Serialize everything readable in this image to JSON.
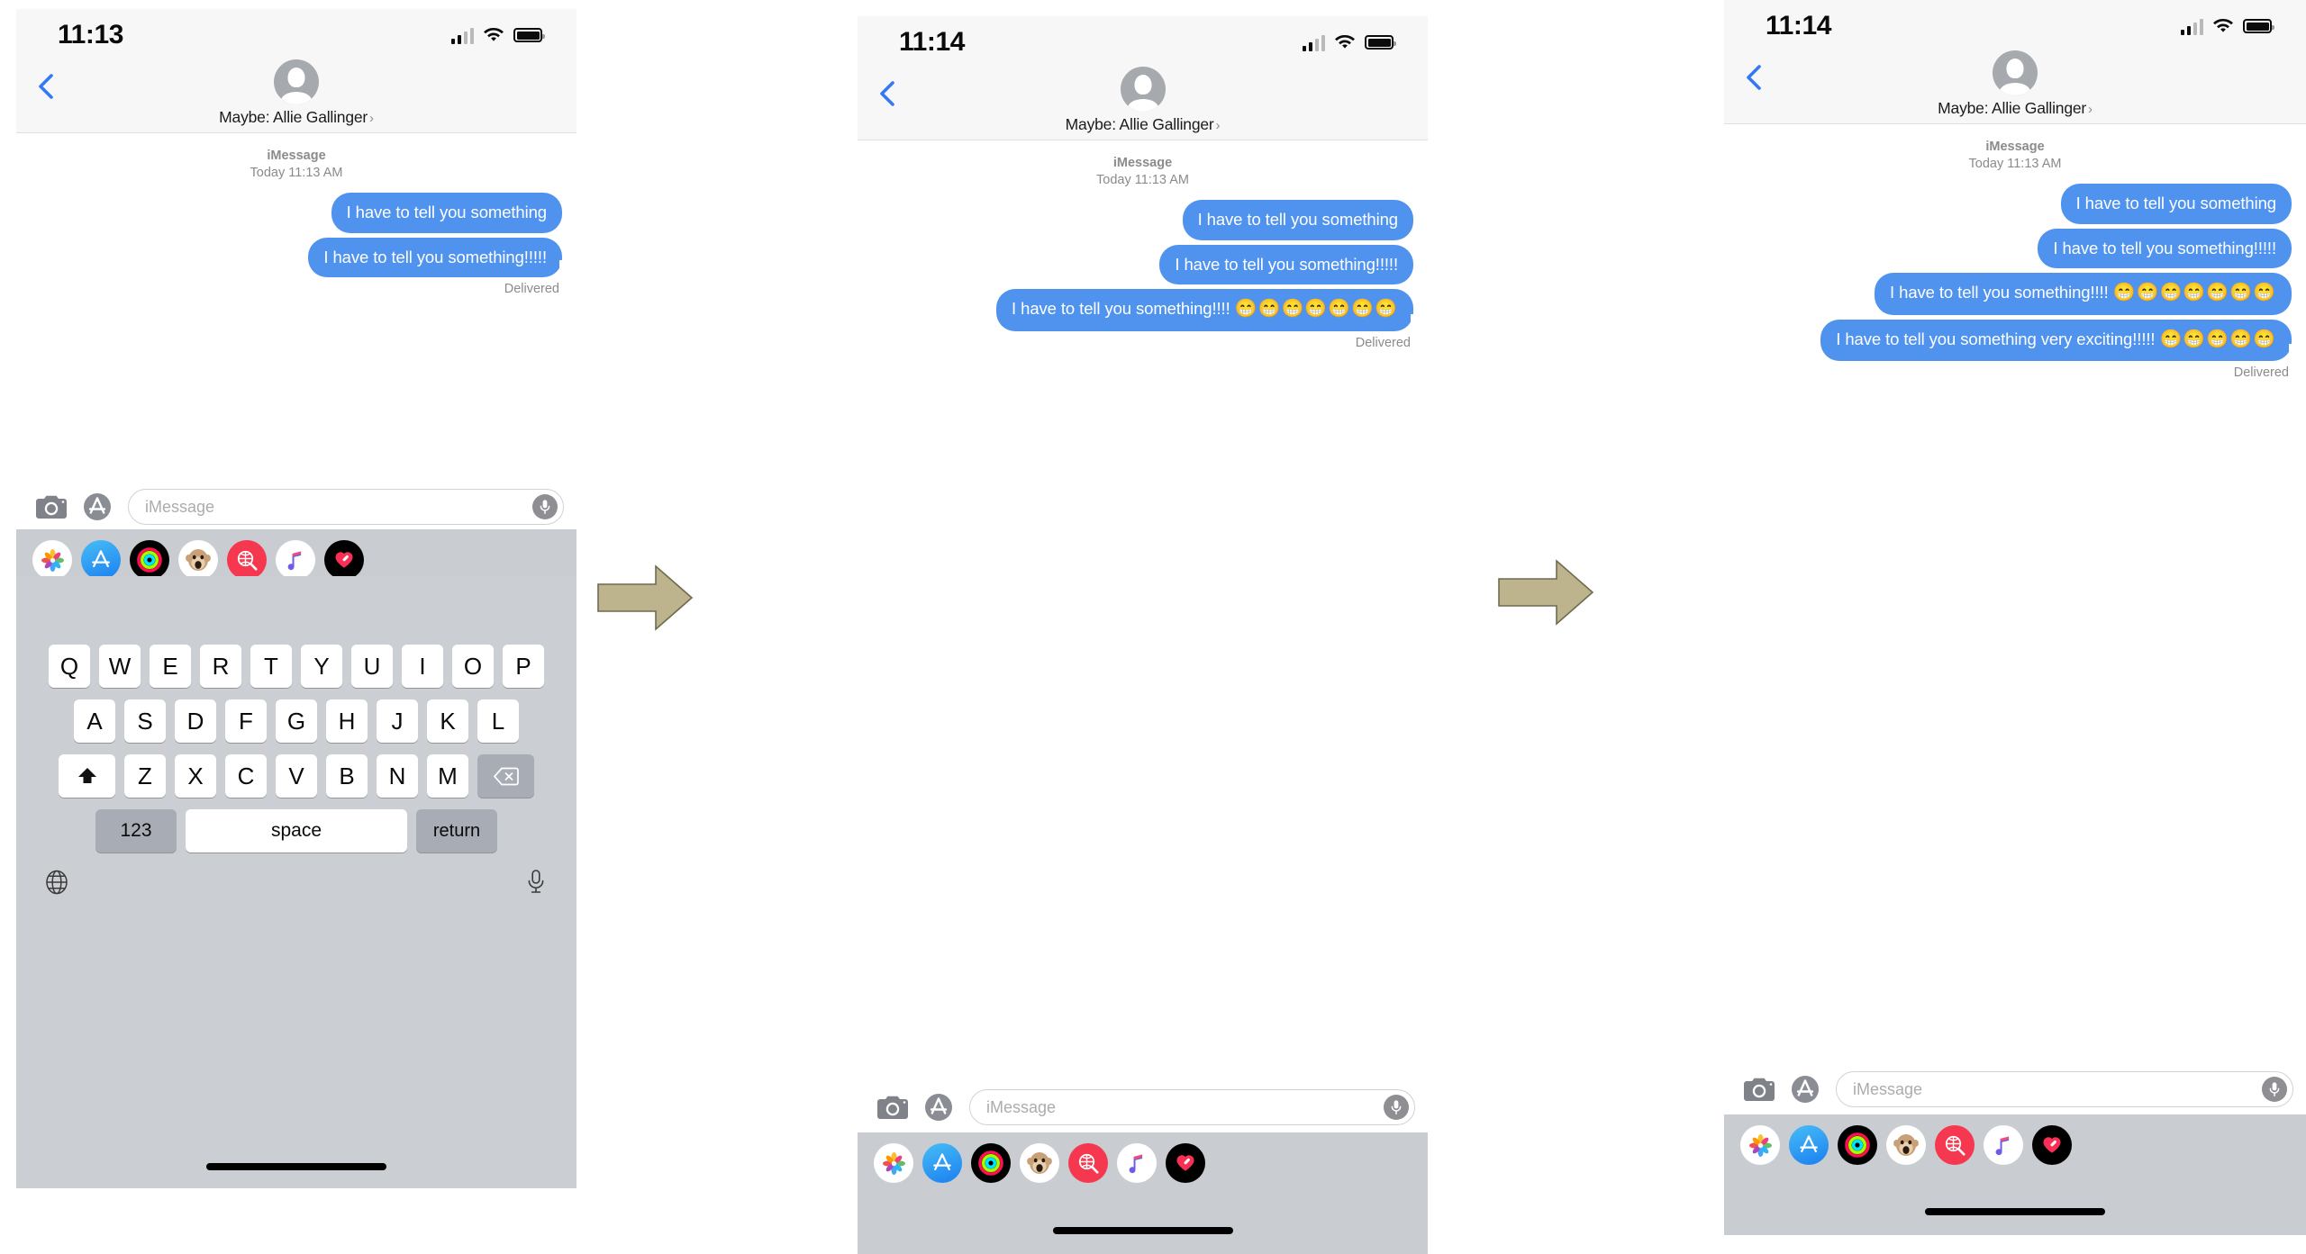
{
  "arrows": {
    "count": 2,
    "color": "#bdb38c",
    "outline": "#6f6a50",
    "label": "flow-arrow-right"
  },
  "theme": {
    "bubble_blue": "#4f93ef",
    "accent_blue": "#3478f6",
    "status_gray": "#8b8b8b",
    "keyboard_bg": "#cbced3",
    "app_strip_bg": "#c9ccd1"
  },
  "common": {
    "nav": {
      "back_label": "back-chevron",
      "contact_name": "Maybe: Allie Gallinger",
      "disclosure": "›"
    },
    "thread_header": {
      "service": "iMessage",
      "timestamp": "Today 11:13 AM"
    },
    "delivered_label": "Delivered",
    "composer": {
      "camera_label": "Camera",
      "appstore_label": "App Store",
      "placeholder": "iMessage",
      "mic_label": "Dictate"
    },
    "app_strip": [
      {
        "name": "photos-app-icon",
        "label": "Photos"
      },
      {
        "name": "app-store-app-icon",
        "label": "App Store"
      },
      {
        "name": "activity-app-icon",
        "label": "Activity"
      },
      {
        "name": "memoji-app-icon",
        "label": "Memoji"
      },
      {
        "name": "music-search-app-icon",
        "label": "Music Search"
      },
      {
        "name": "apple-music-app-icon",
        "label": "Music"
      },
      {
        "name": "health-app-icon",
        "label": "Health"
      }
    ],
    "keyboard": {
      "row1": [
        "Q",
        "W",
        "E",
        "R",
        "T",
        "Y",
        "U",
        "I",
        "O",
        "P"
      ],
      "row2": [
        "A",
        "S",
        "D",
        "F",
        "G",
        "H",
        "J",
        "K",
        "L"
      ],
      "row3": [
        "Z",
        "X",
        "C",
        "V",
        "B",
        "N",
        "M"
      ],
      "shift_label": "shift",
      "delete_label": "delete",
      "numbers_label": "123",
      "space_label": "space",
      "return_label": "return",
      "globe_label": "emoji-globe",
      "dictate_label": "dictate"
    }
  },
  "panels": [
    {
      "id": "panel-1",
      "status": {
        "time": "11:13",
        "signal": "signal-icon",
        "wifi": "wifi-icon",
        "battery": "battery-icon"
      },
      "messages": [
        {
          "text": "I have to tell you something",
          "emoji": "",
          "tail": false
        },
        {
          "text": "I have to tell you something!!!!!",
          "emoji": "",
          "tail": true
        }
      ],
      "has_keyboard": true
    },
    {
      "id": "panel-2",
      "status": {
        "time": "11:14",
        "signal": "signal-icon",
        "wifi": "wifi-icon",
        "battery": "battery-icon"
      },
      "messages": [
        {
          "text": "I have to tell you something",
          "emoji": "",
          "tail": false
        },
        {
          "text": "I have to tell you something!!!!!",
          "emoji": "",
          "tail": false
        },
        {
          "text": "I have to tell you something!!!! ",
          "emoji": "😁😁😁😁😁😁😁",
          "tail": true
        }
      ],
      "has_keyboard": false
    },
    {
      "id": "panel-3",
      "status": {
        "time": "11:14",
        "signal": "signal-icon",
        "wifi": "wifi-icon",
        "battery": "battery-icon"
      },
      "messages": [
        {
          "text": "I have to tell you something",
          "emoji": "",
          "tail": false
        },
        {
          "text": "I have to tell you something!!!!!",
          "emoji": "",
          "tail": false
        },
        {
          "text": "I have to tell you something!!!! ",
          "emoji": "😁😁😁😁😁😁😁",
          "tail": false
        },
        {
          "text": "I have to tell you something very exciting!!!!! ",
          "emoji": "😁😁😁😁😁",
          "tail": true
        }
      ],
      "has_keyboard": false
    }
  ]
}
